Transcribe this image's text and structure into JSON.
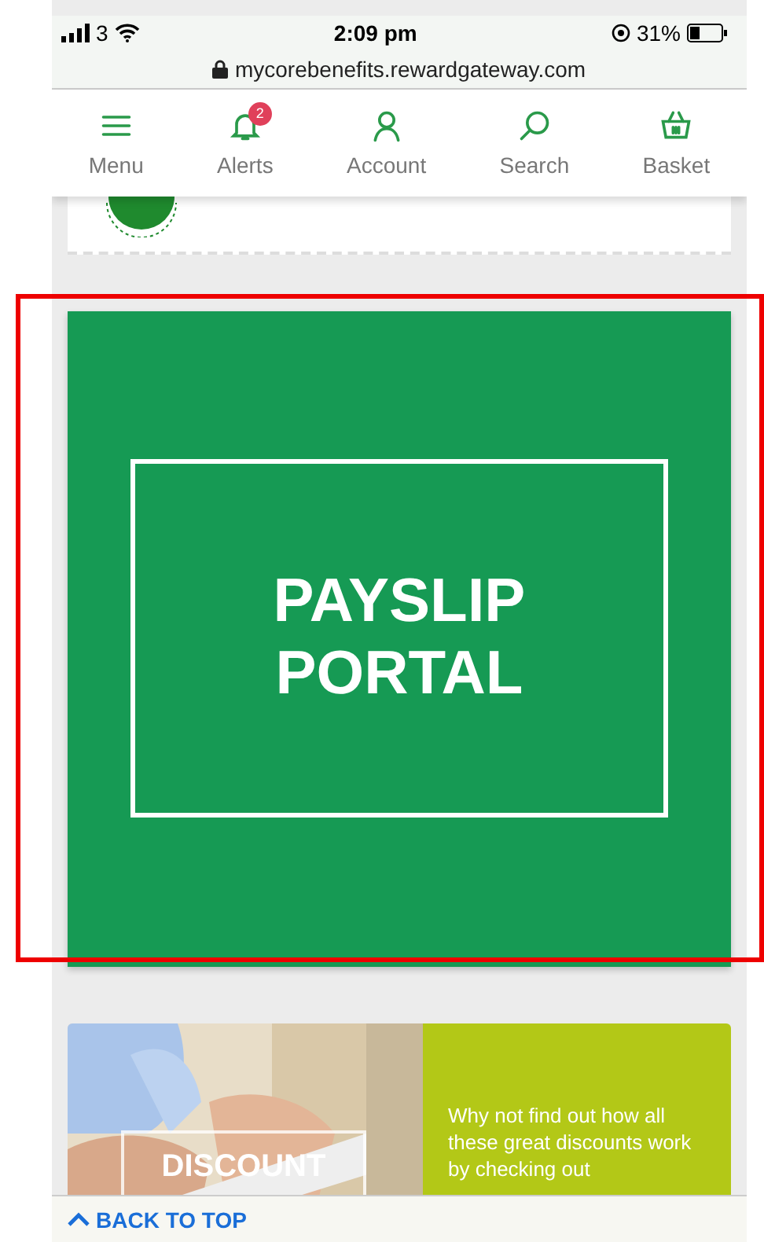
{
  "status_bar": {
    "carrier": "3",
    "time": "2:09 pm",
    "battery": "31%"
  },
  "address_bar": {
    "url": "mycorebenefits.rewardgateway.com"
  },
  "nav": [
    {
      "label": "Menu",
      "kind": "menu"
    },
    {
      "label": "Alerts",
      "kind": "alerts",
      "badge": "2"
    },
    {
      "label": "Account",
      "kind": "account"
    },
    {
      "label": "Search",
      "kind": "search"
    },
    {
      "label": "Basket",
      "kind": "basket"
    }
  ],
  "banner": {
    "title_lines": [
      "PAYSLIP",
      "PORTAL"
    ]
  },
  "tutorial_tile": {
    "title": "DISCOUNT",
    "text": "Why not find out how all these great discounts work by checking out"
  },
  "back_to_top": {
    "label": "BACK TO TOP"
  }
}
